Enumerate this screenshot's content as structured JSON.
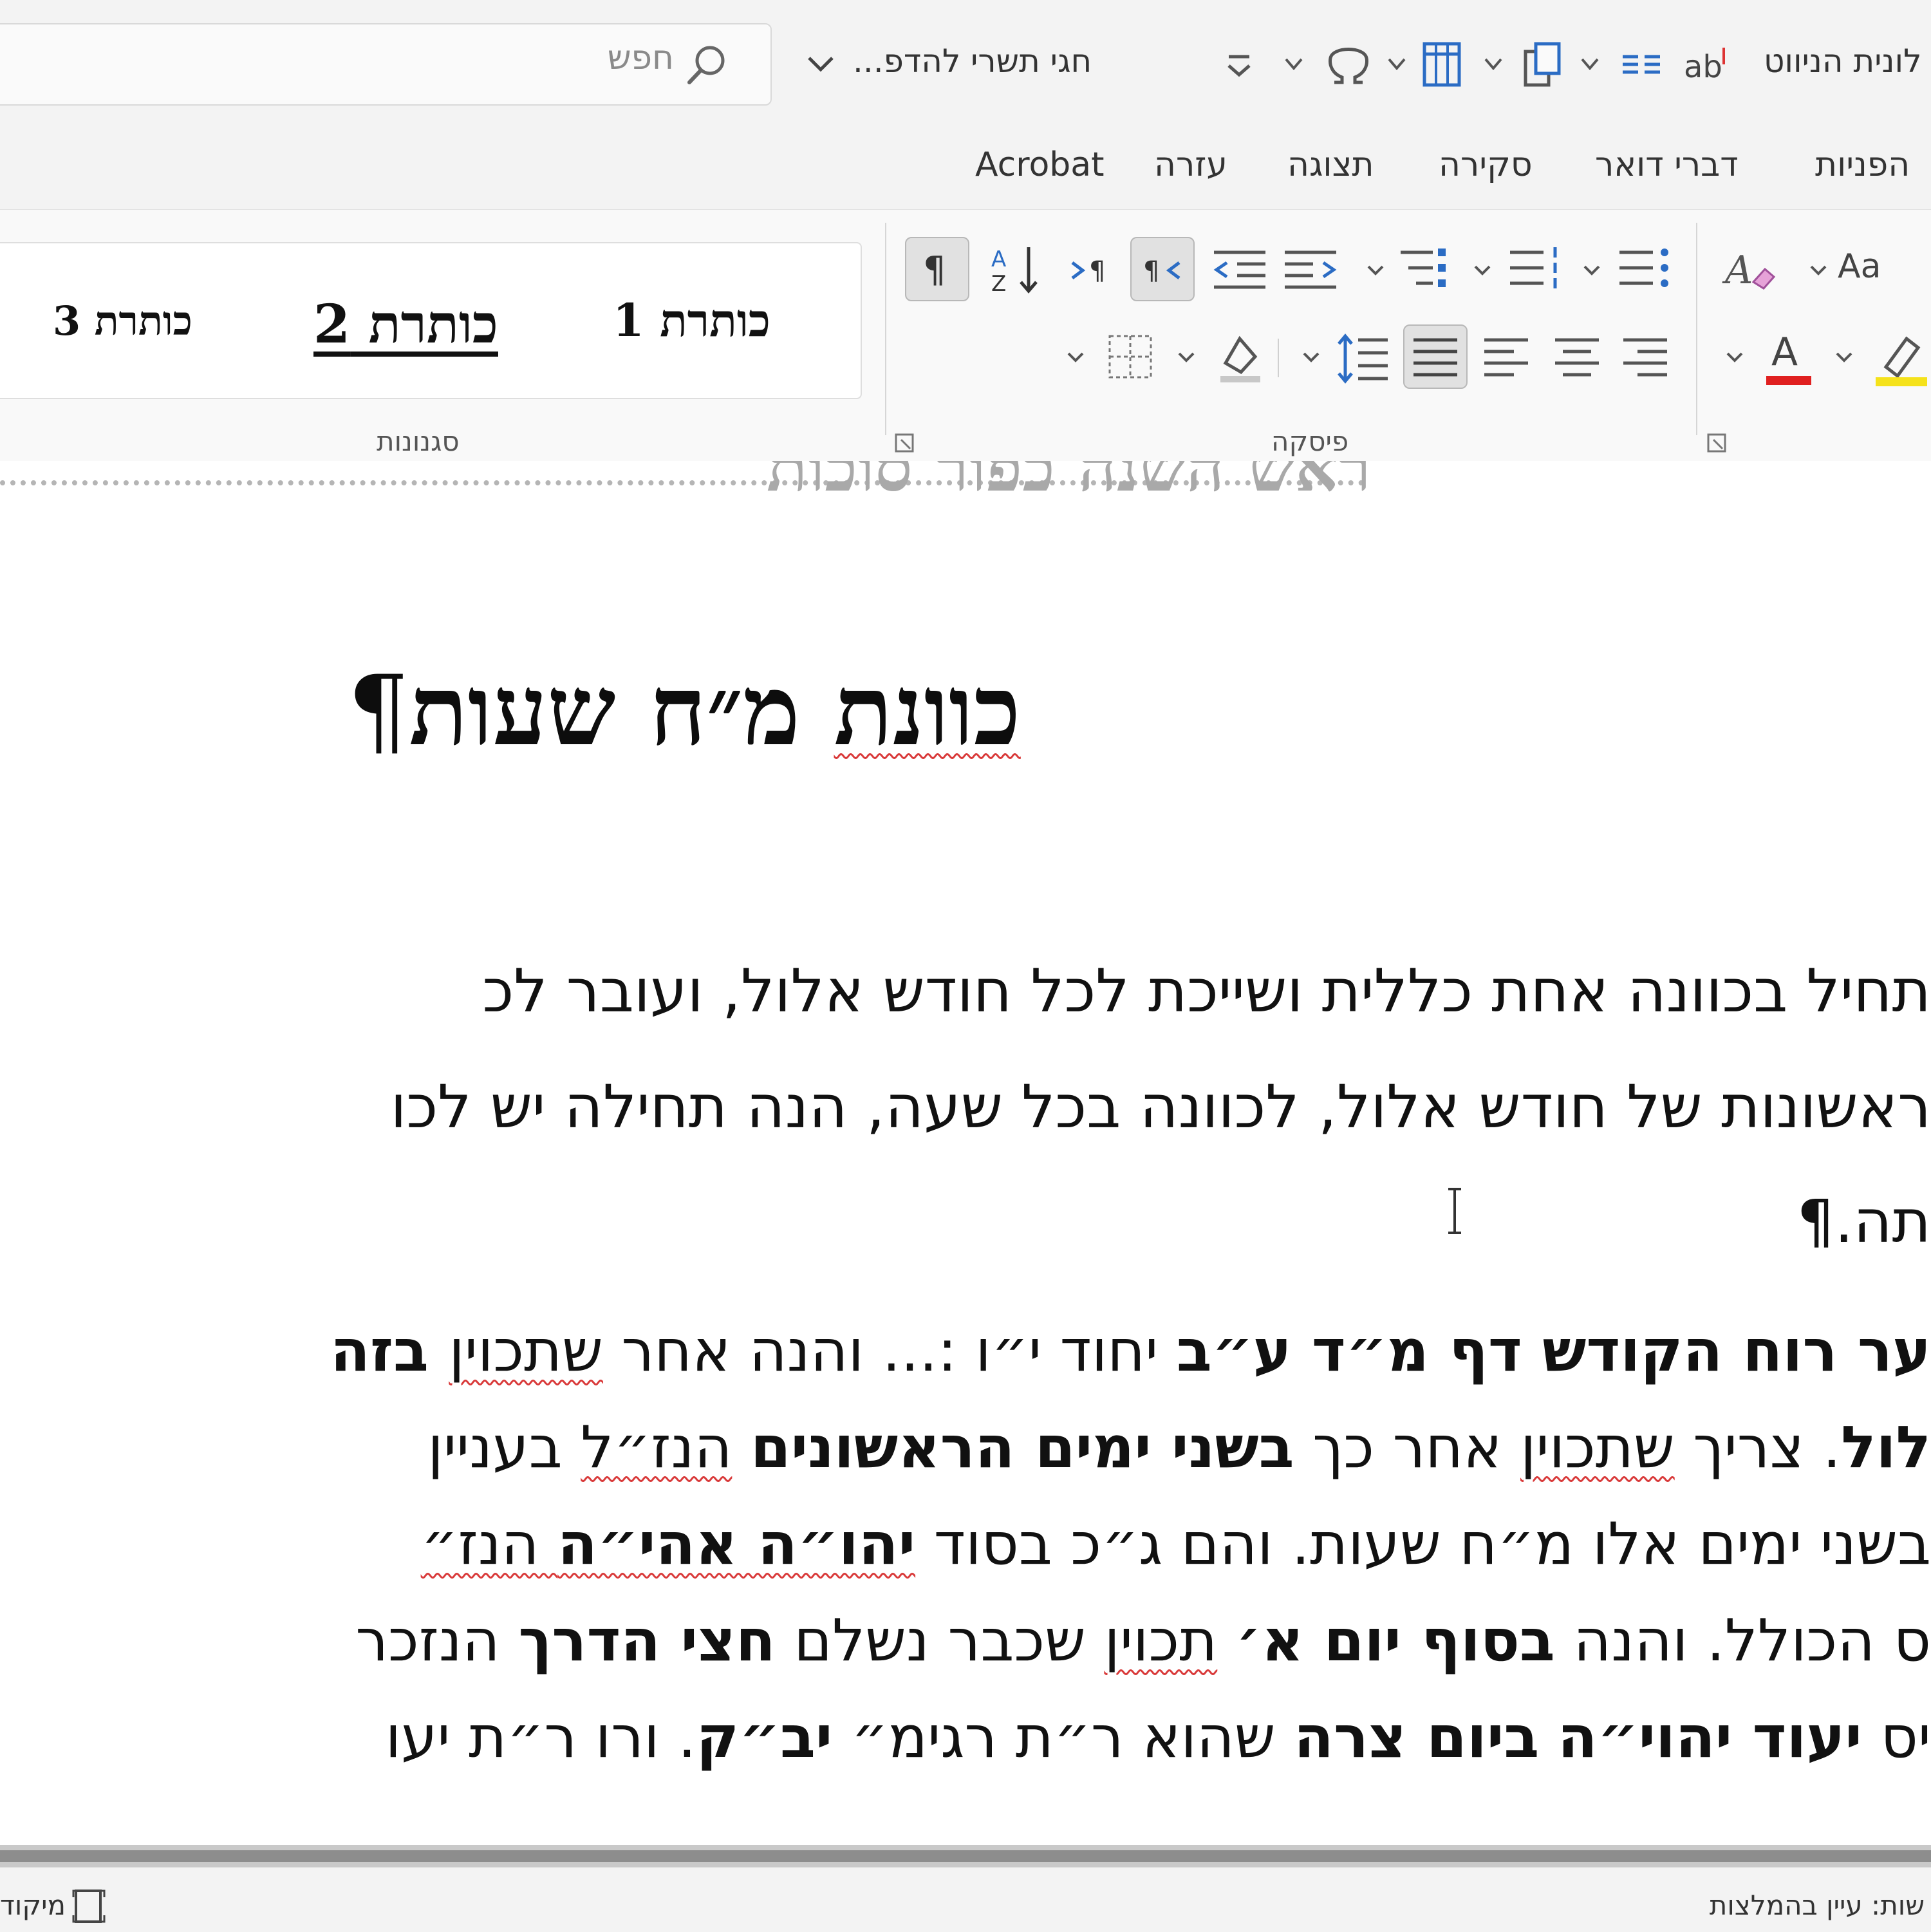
{
  "qat": {
    "search_placeholder": "חפש",
    "doc_title": "חגי תשרי להדפ...",
    "layout_pane": "לונית הניווט"
  },
  "tabs": [
    {
      "label": "Acrobat"
    },
    {
      "label": "עזרה"
    },
    {
      "label": "תצוגה"
    },
    {
      "label": "סקירה"
    },
    {
      "label": "דברי דואר"
    },
    {
      "label": "הפניות"
    }
  ],
  "ribbon": {
    "styles": [
      {
        "label": "כותרת 1"
      },
      {
        "label": "כותרת 2"
      },
      {
        "label": "כותרת 3"
      }
    ],
    "group_styles": "סגנונות",
    "group_paragraph": "פיסקה",
    "font_case_label": "Aa",
    "font_color_letter": "A",
    "colors": {
      "font_color": "#e02020",
      "highlight": "#f5e21b",
      "accent": "#2b6cc4"
    }
  },
  "document": {
    "header_text": "ראש השנה כפור סוכות",
    "title": "כוונת מ״ח שעות",
    "title_spell_word": "כוונת",
    "pilcrow": "¶",
    "p1_line1": "תחיל בכוונה אחת כללית ושייכת לכל חודש אלול, ועובר לכ",
    "p1_line2": "ראשונות של חודש אלול, לכוונה בכל שעה, הנה תחילה יש לכו",
    "p1_line3": "תה.¶",
    "p2_line1_a": "ער רוח הקודש דף מ״ד ע״ב",
    "p2_line1_b": " יחוד י״ו :... והנה אחר ",
    "p2_line1_c": "שתכוין",
    "p2_line1_d": " בזה",
    "p2_line2_a": "לול",
    "p2_line2_b": ". צריך ",
    "p2_line2_c": "שתכוין",
    "p2_line2_d": " אחר כך ",
    "p2_line2_e": "בשני ימים הראשונים",
    "p2_line2_f": " ",
    "p2_line2_g": "הנז״ל",
    "p2_line2_h": " בעניין",
    "p2_line3_a": " בשני ימים אלו מ״ח שעות. והם ג״כ בסוד ",
    "p2_line3_b": "יהו״ה אהי״ה",
    "p2_line3_c": " הנז״",
    "p2_line4_a": "ס הכולל. והנה ",
    "p2_line4_b": "בסוף יום א׳",
    "p2_line4_c": " ",
    "p2_line4_d": "תכוין",
    "p2_line4_e": " שכבר נשלם ",
    "p2_line4_f": "חצי הדרך",
    "p2_line4_g": " הנזכר",
    "p2_line5_a": "יס ",
    "p2_line5_b": "יעוד יהוי״ה",
    "p2_line5_c": " ",
    "p2_line5_d": "ביום צרה",
    "p2_line5_e": " שהוא ר״ת רגימ״ ",
    "p2_line5_f": "יב״ק",
    "p2_line5_g": ". ורו ר״ת יעו"
  },
  "status": {
    "left_text": "מיקוד",
    "right_text": "שות: עיין בהמלצות"
  }
}
